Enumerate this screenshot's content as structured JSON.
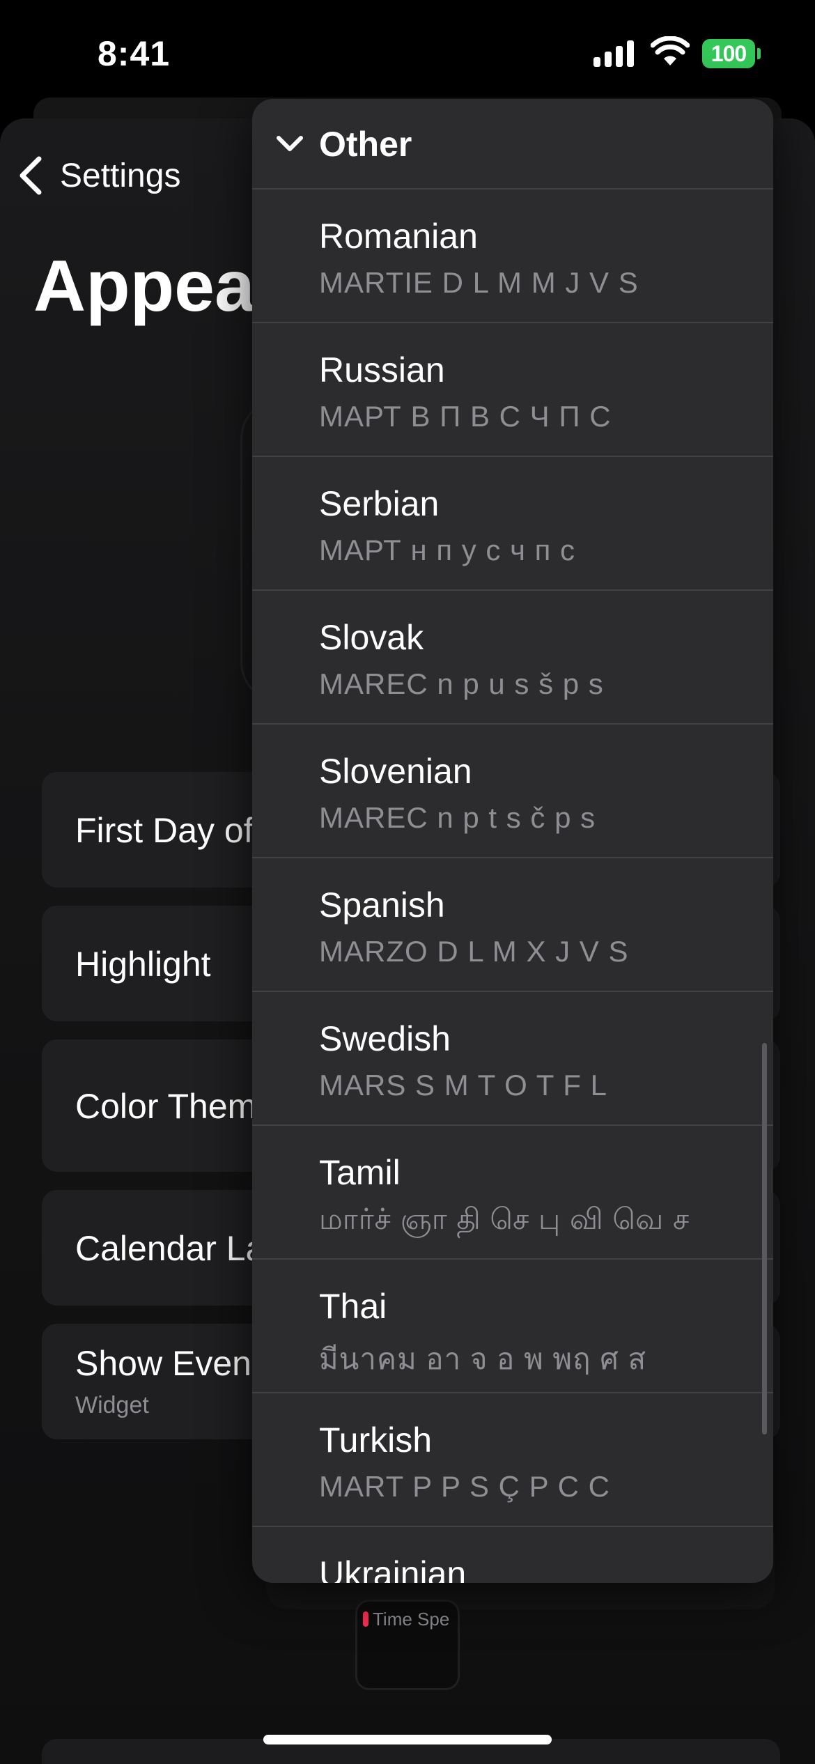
{
  "status_bar": {
    "time": "8:41",
    "battery_level": "100",
    "battery_color": "#34c759"
  },
  "background": {
    "back_label": "Settings",
    "title": "Appea",
    "rows": {
      "first_day": "First Day of",
      "highlight": "Highlight",
      "color_theme": "Color Them",
      "calendar_layout": "Calendar La",
      "show_events": "Show Even",
      "show_events_sub": "Widget"
    },
    "widget_preview_text": "Time Spe",
    "widget_accent": "#ff2d55"
  },
  "menu": {
    "header_icon": "chevron-down-icon",
    "header": "Other",
    "items": [
      {
        "name": "Romanian",
        "sample": "MARTIE D L M M J V S"
      },
      {
        "name": "Russian",
        "sample": "МАРТ В П В С Ч П С"
      },
      {
        "name": "Serbian",
        "sample": "МАРТ н п у с ч п с"
      },
      {
        "name": "Slovak",
        "sample": "MAREC n p u s š p s"
      },
      {
        "name": "Slovenian",
        "sample": "MAREC n p t s č p s"
      },
      {
        "name": "Spanish",
        "sample": "MARZO D L M X J V S"
      },
      {
        "name": "Swedish",
        "sample": "MARS S M T O T F L"
      },
      {
        "name": "Tamil",
        "sample": "மார்ச் ஞா தி செ பு வி வெ ச"
      },
      {
        "name": "Thai",
        "sample": "มีนาคม อา จ อ พ พฤ ศ ส"
      },
      {
        "name": "Turkish",
        "sample": "MART P P S Ç P C C"
      },
      {
        "name": "Ukrainian",
        "sample": ""
      }
    ]
  }
}
